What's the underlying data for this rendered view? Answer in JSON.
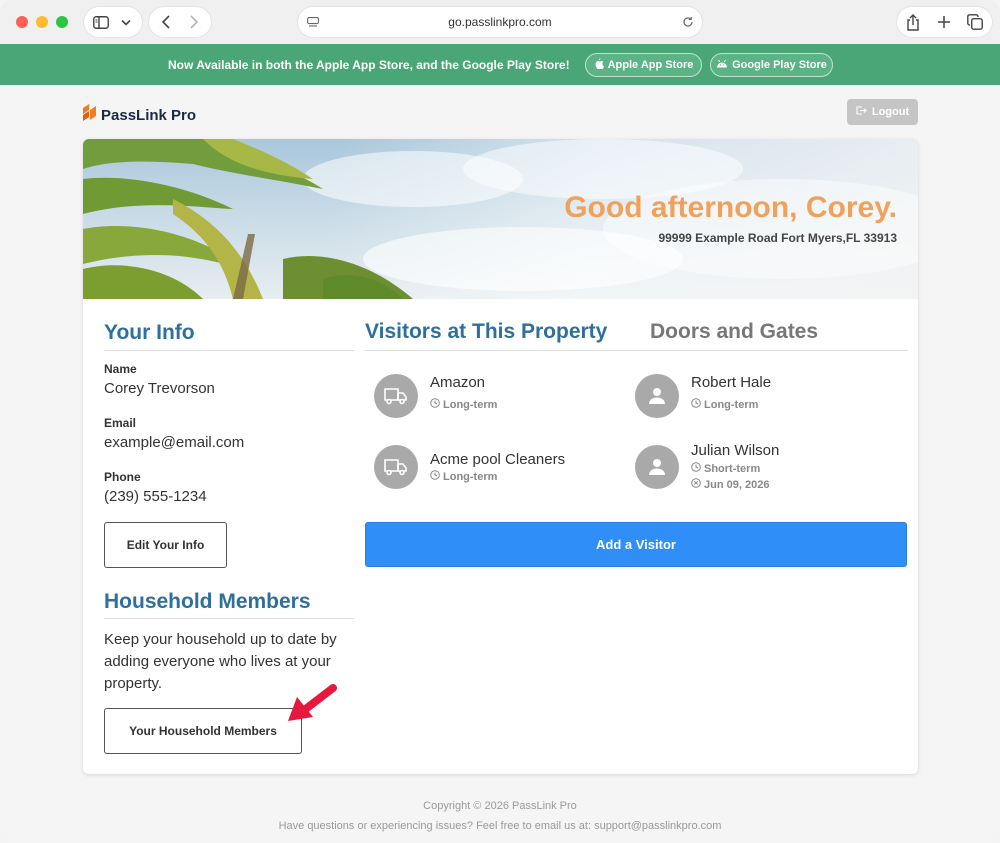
{
  "browser": {
    "url": "go.passlinkpro.com"
  },
  "banner": {
    "text": "Now Available in both the Apple App Store, and the Google Play Store!",
    "apple_label": "Apple App Store",
    "google_label": "Google Play Store",
    "color": "#4aa677"
  },
  "header": {
    "logo_text": "PassLink Pro",
    "logout_label": "Logout"
  },
  "hero": {
    "greeting": "Good afternoon, Corey.",
    "address": "99999 Example Road Fort Myers,FL 33913"
  },
  "your_info": {
    "title": "Your Info",
    "name_label": "Name",
    "name_value": "Corey Trevorson",
    "email_label": "Email",
    "email_value": "example@email.com",
    "phone_label": "Phone",
    "phone_value": "(239) 555-1234",
    "edit_label": "Edit Your Info"
  },
  "household": {
    "title": "Household Members",
    "description": "Keep your household up to date by adding everyone who lives at your property.",
    "button_label": "Your Household Members"
  },
  "tabs": {
    "visitors": "Visitors at This Property",
    "doors": "Doors and Gates"
  },
  "visitors": [
    {
      "name": "Amazon",
      "icon": "truck-icon",
      "term": "Long-term"
    },
    {
      "name": "Robert Hale",
      "icon": "person-icon",
      "term": "Long-term"
    },
    {
      "name": "Acme pool Cleaners",
      "icon": "truck-icon",
      "term": "Long-term"
    },
    {
      "name": "Julian Wilson",
      "icon": "person-icon",
      "term": "Short-term",
      "expires": "Jun 09, 2026"
    }
  ],
  "add_visitor_label": "Add a Visitor",
  "footer": {
    "copyright": "Copyright © 2026 PassLink Pro",
    "help": "Have questions or experiencing issues? Feel free to email us at: support@passlinkpro.com"
  },
  "colors": {
    "accent_blue": "#2f8ef7",
    "title_blue": "#2e6f9e",
    "greeting_orange": "#f0a25c"
  }
}
